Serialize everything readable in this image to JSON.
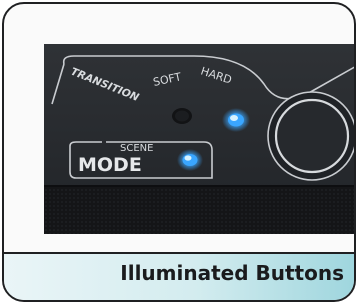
{
  "photo": {
    "label_transition": "TRANSITION",
    "label_soft": "SOFT",
    "label_hard": "HARD",
    "label_scene": "SCENE",
    "label_mode": "MODE",
    "soft_led": "off",
    "hard_led": "on",
    "scene_led": "on",
    "colors": {
      "panel": "#2a2d31",
      "grille": "#17181a",
      "led_on": "#3aa6ff",
      "led_off": "#1b1d20",
      "print": "#d9dcdf"
    }
  },
  "caption": {
    "text": "Illuminated Buttons",
    "colors": {
      "bar_start": "#eaf5f7",
      "bar_end": "#9fd6de",
      "border": "#1f2022"
    }
  }
}
